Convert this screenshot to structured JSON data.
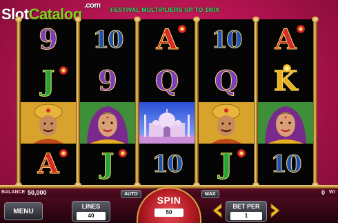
{
  "brand": {
    "slot": "Slot",
    "catalog": "Catalog",
    "dotcom": ".com"
  },
  "banner": "FESTIVAL MULTIPLIERS UP TO 100X",
  "reels": [
    [
      {
        "type": "letter",
        "text": "9",
        "cls": "nine"
      },
      {
        "type": "letter",
        "text": "J",
        "cls": "jack",
        "flower": "red"
      },
      {
        "type": "pic",
        "icon": "maharaja-symbol"
      },
      {
        "type": "letter",
        "text": "A",
        "cls": "ace",
        "flower": "red"
      }
    ],
    [
      {
        "type": "letter",
        "text": "10",
        "cls": "ten"
      },
      {
        "type": "letter",
        "text": "9",
        "cls": "nine"
      },
      {
        "type": "pic",
        "icon": "princess-symbol"
      },
      {
        "type": "letter",
        "text": "J",
        "cls": "jack",
        "flower": "red"
      }
    ],
    [
      {
        "type": "letter",
        "text": "A",
        "cls": "ace",
        "flower": "red"
      },
      {
        "type": "letter",
        "text": "Q",
        "cls": "queen"
      },
      {
        "type": "pic",
        "icon": "taj-mahal-symbol"
      },
      {
        "type": "letter",
        "text": "10",
        "cls": "ten"
      }
    ],
    [
      {
        "type": "letter",
        "text": "10",
        "cls": "ten"
      },
      {
        "type": "letter",
        "text": "Q",
        "cls": "queen"
      },
      {
        "type": "pic",
        "icon": "maharaja-symbol"
      },
      {
        "type": "letter",
        "text": "J",
        "cls": "jack",
        "flower": "red"
      }
    ],
    [
      {
        "type": "letter",
        "text": "A",
        "cls": "ace",
        "flower": "red"
      },
      {
        "type": "letter",
        "text": "K",
        "cls": "king",
        "flower": "gold"
      },
      {
        "type": "pic",
        "icon": "princess-symbol"
      },
      {
        "type": "letter",
        "text": "10",
        "cls": "ten"
      }
    ]
  ],
  "status": {
    "balance_label": "BALANCE",
    "balance_value": "50,000",
    "win_value": "0",
    "win_label": "WI"
  },
  "controls": {
    "menu": "MENU",
    "lines_label": "LINES",
    "lines_value": "40",
    "auto": "AUTO",
    "max": "MAX",
    "spin_label": "SPIN",
    "spin_value": "50",
    "betper_label": "BET PER",
    "betper_value": "1"
  },
  "colors": {
    "accent": "#d9a441",
    "background": "#b81552",
    "banner": "#2ee06a"
  }
}
